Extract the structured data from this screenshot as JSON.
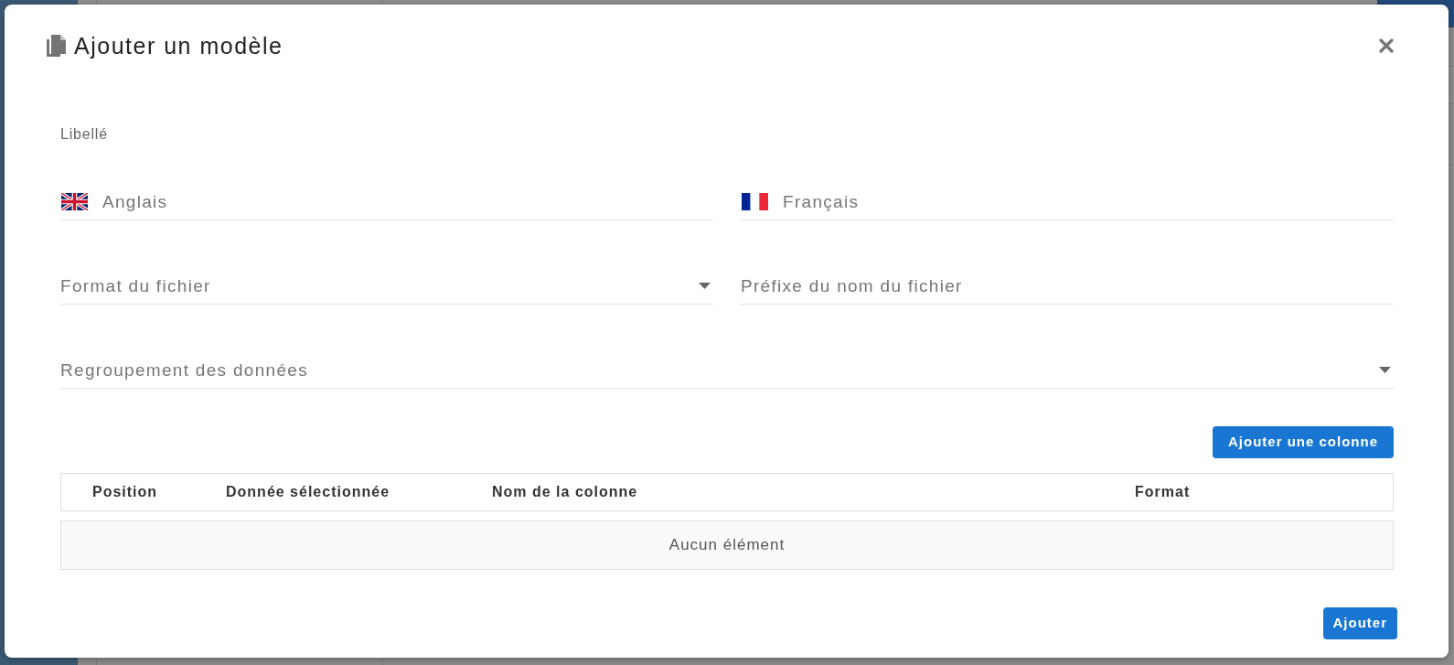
{
  "dialog": {
    "title": "Ajouter un modèle"
  },
  "section_label": "Libellé",
  "form_rows": [
    {
      "fields": [
        {
          "kind": "language",
          "placeholder": "Anglais"
        },
        {
          "kind": "language",
          "placeholder": "Français"
        }
      ]
    },
    {
      "fields": [
        {
          "kind": "select",
          "placeholder": "Format du fichier"
        },
        {
          "kind": "text",
          "placeholder": "Préfixe du nom du fichier"
        }
      ]
    },
    {
      "fields": [
        {
          "kind": "select",
          "placeholder": "Regroupement des données"
        }
      ]
    }
  ],
  "add_column_button": "Ajouter une colonne",
  "table": {
    "columns": [
      "Position",
      "Donnée sélectionnée",
      "Nom de la colonne",
      "Format"
    ],
    "empty_text": "Aucun élément"
  },
  "footer_buttons": [
    "Ajouter"
  ]
}
